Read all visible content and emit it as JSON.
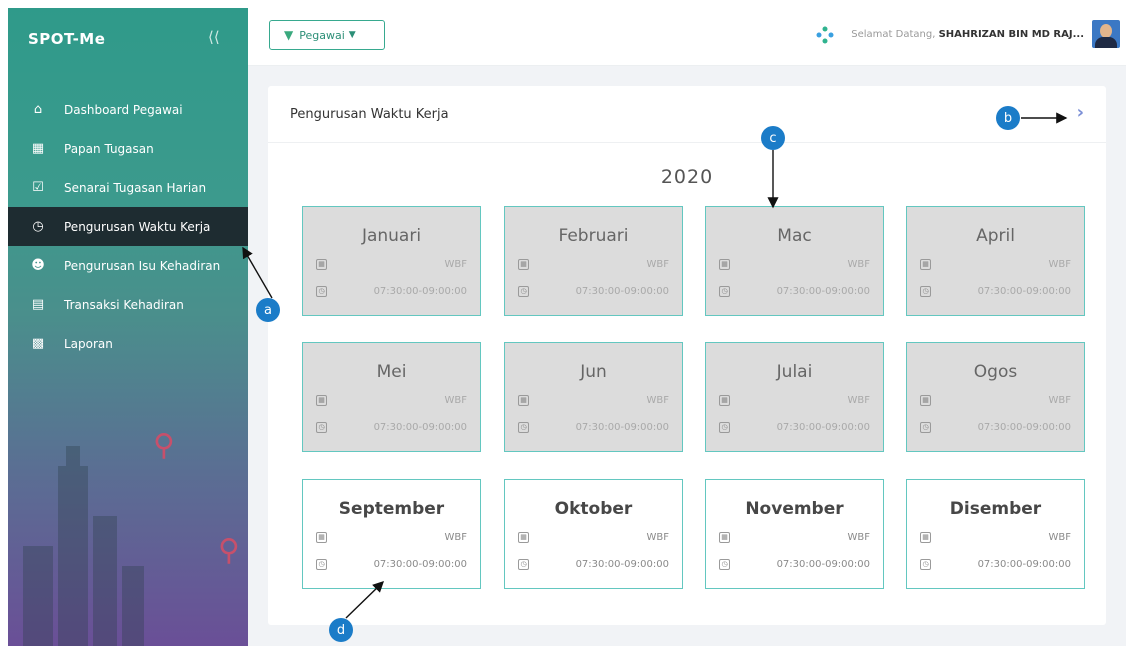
{
  "brand": "SPOT-Me",
  "sidebar": {
    "items": [
      {
        "icon": "home-icon",
        "label": "Dashboard Pegawai",
        "active": false
      },
      {
        "icon": "board-icon",
        "label": "Papan Tugasan",
        "active": false
      },
      {
        "icon": "checklist-icon",
        "label": "Senarai Tugasan Harian",
        "active": false
      },
      {
        "icon": "clock-icon",
        "label": "Pengurusan Waktu Kerja",
        "active": true
      },
      {
        "icon": "user-icon",
        "label": "Pengurusan Isu Kehadiran",
        "active": false
      },
      {
        "icon": "list-icon",
        "label": "Transaksi Kehadiran",
        "active": false
      },
      {
        "icon": "report-icon",
        "label": "Laporan",
        "active": false
      }
    ]
  },
  "topbar": {
    "role_label": "Pegawai",
    "welcome_text": "Selamat Datang,",
    "user_name": "SHAHRIZAN BIN MD RAJ..."
  },
  "main": {
    "title": "Pengurusan Waktu Kerja",
    "year": "2020",
    "months": [
      {
        "name": "Januari",
        "code": "WBF",
        "time": "07:30:00-09:00:00",
        "enabled": false
      },
      {
        "name": "Februari",
        "code": "WBF",
        "time": "07:30:00-09:00:00",
        "enabled": false
      },
      {
        "name": "Mac",
        "code": "WBF",
        "time": "07:30:00-09:00:00",
        "enabled": false
      },
      {
        "name": "April",
        "code": "WBF",
        "time": "07:30:00-09:00:00",
        "enabled": false
      },
      {
        "name": "Mei",
        "code": "WBF",
        "time": "07:30:00-09:00:00",
        "enabled": false
      },
      {
        "name": "Jun",
        "code": "WBF",
        "time": "07:30:00-09:00:00",
        "enabled": false
      },
      {
        "name": "Julai",
        "code": "WBF",
        "time": "07:30:00-09:00:00",
        "enabled": false
      },
      {
        "name": "Ogos",
        "code": "WBF",
        "time": "07:30:00-09:00:00",
        "enabled": false
      },
      {
        "name": "September",
        "code": "WBF",
        "time": "07:30:00-09:00:00",
        "enabled": true
      },
      {
        "name": "Oktober",
        "code": "WBF",
        "time": "07:30:00-09:00:00",
        "enabled": true
      },
      {
        "name": "November",
        "code": "WBF",
        "time": "07:30:00-09:00:00",
        "enabled": true
      },
      {
        "name": "Disember",
        "code": "WBF",
        "time": "07:30:00-09:00:00",
        "enabled": true
      }
    ]
  },
  "annotations": [
    "a",
    "b",
    "c",
    "d"
  ],
  "colors": {
    "accent": "#37a98f",
    "badge": "#1b7cc8",
    "sidebar_active": "#1e2c31"
  }
}
